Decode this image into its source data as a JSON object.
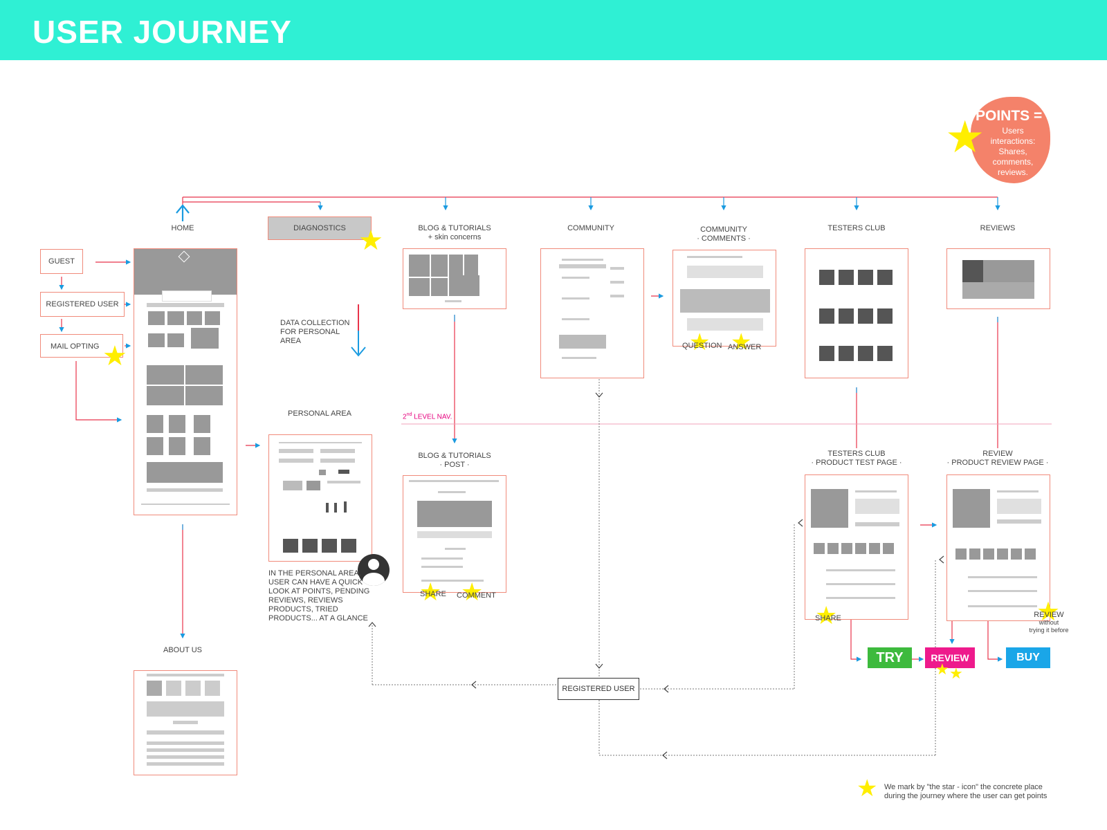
{
  "title": "USER JOURNEY",
  "points": {
    "heading": "POINTS =",
    "lines": [
      "Users",
      "interactions:",
      "Shares,",
      "comments,",
      "reviews."
    ]
  },
  "user_types": {
    "guest": "GUEST",
    "registered": "REGISTERED USER",
    "mail": "MAIL OPTING"
  },
  "pages": {
    "home": "HOME",
    "diagnostics": "DIAGNOSTICS",
    "blog_line1": "BLOG & TUTORIALS",
    "blog_line2": "+ skin concerns",
    "community": "COMMUNITY",
    "comm_comments_line1": "COMMUNITY",
    "comm_comments_line2": "· COMMENTS ·",
    "testers": "TESTERS CLUB",
    "reviews": "REVIEWS",
    "personal": "PERSONAL AREA",
    "blog_post_line1": "BLOG & TUTORIALS",
    "blog_post_line2": "· POST ·",
    "testers_test_line1": "TESTERS CLUB",
    "testers_test_line2": "· PRODUCT TEST PAGE ·",
    "review_page_line1": "REVIEW",
    "review_page_line2": "· PRODUCT REVIEW PAGE ·",
    "about": "ABOUT US"
  },
  "notes": {
    "data_collection": [
      "DATA COLLECTION",
      "FOR PERSONAL",
      "AREA"
    ],
    "personal_desc": [
      "IN THE PERSONAL AREA,",
      "USER CAN HAVE A QUICK",
      "LOOK AT POINTS, PENDING",
      "REVIEWS, REVIEWS",
      "PRODUCTS, TRIED",
      "PRODUCTS... AT A GLANCE"
    ],
    "second_level_main": "2",
    "second_level_sup": "nd",
    "second_level_rest": " LEVEL NAV.",
    "registered_user_box": "REGISTERED USER",
    "legend": [
      "We mark by \"the star - icon\" the concrete place",
      "during the journey where the user can get points"
    ]
  },
  "star_labels": {
    "question": "QUESTION",
    "answer": "ANSWER",
    "share": "SHARE",
    "comment": "COMMENT",
    "share2": "SHARE",
    "review_main": "REVIEW",
    "review_sub1": "without",
    "review_sub2": "trying it before"
  },
  "actions": {
    "try": "TRY",
    "review": "REVIEW",
    "buy": "BUY"
  },
  "colors": {
    "header": "#2ff0d4",
    "points_blob": "#f4826a",
    "star": "#ffee00",
    "try": "#3dba3d",
    "review": "#ee1a8c",
    "buy": "#1aa6e8",
    "connector_red": "#e8334a",
    "connector_blue": "#1a9be0",
    "wireframe_border": "#f08a7a",
    "second_level": "#e6007e"
  }
}
